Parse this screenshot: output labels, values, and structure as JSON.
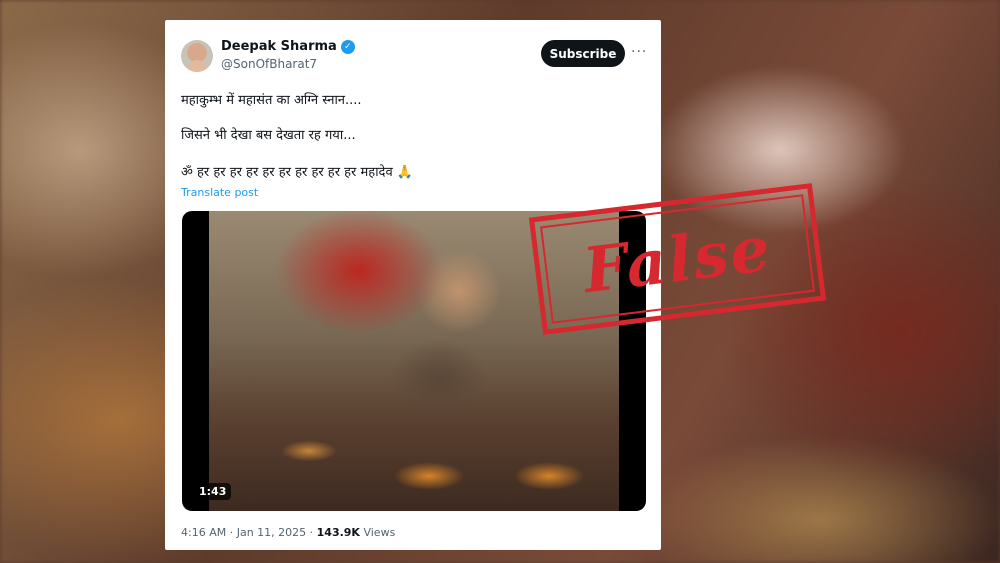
{
  "post": {
    "author_name": "Deepak Sharma",
    "verified_glyph": "✓",
    "handle": "@SonOfBharat7",
    "subscribe_label": "Subscribe",
    "more_label": "···",
    "text_lines": [
      "महाकुम्भ में महासंत का अग्नि स्नान....",
      "जिसने भी देखा बस देखता रह गया...",
      "ॐ हर हर हर हर हर हर हर हर हर हर महादेव 🙏"
    ],
    "translate_label": "Translate post",
    "video_duration": "1:43",
    "timestamp": "4:16 AM · Jan 11, 2025 ·",
    "views_count": "143.9K",
    "views_label": "Views"
  },
  "stamp": {
    "text": "False",
    "color": "#d6282f"
  },
  "colors": {
    "verified_blue": "#1d9bf0",
    "button_black": "#0f1419",
    "secondary_text": "#536471"
  }
}
